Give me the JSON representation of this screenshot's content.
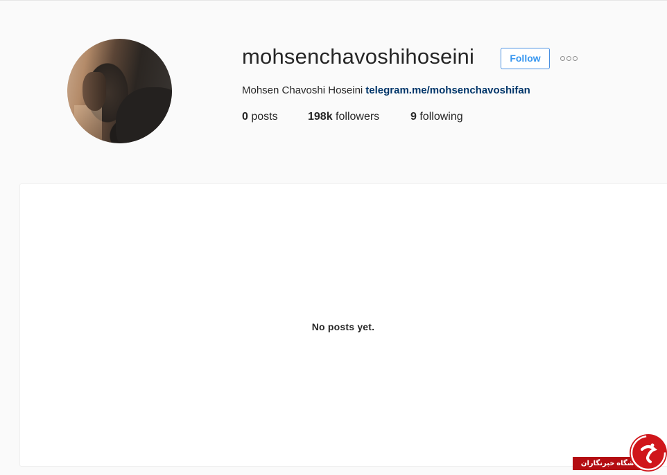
{
  "profile": {
    "username": "mohsenchavoshihoseini",
    "follow_label": "Follow",
    "full_name": "Mohsen Chavoshi Hoseini",
    "bio_link": "telegram.me/mohsenchavoshifan",
    "stats": {
      "posts_count": "0",
      "posts_label": "posts",
      "followers_count": "198k",
      "followers_label": "followers",
      "following_count": "9",
      "following_label": "following"
    }
  },
  "icons": {
    "more": "more-options-icon",
    "avatar": "profile-photo"
  },
  "posts": {
    "empty_message": "No posts yet."
  },
  "watermark": {
    "text": "باشگاه خبرنگاران"
  },
  "colors": {
    "follow_accent": "#3897f0",
    "link": "#003569",
    "background": "#fafafa",
    "watermark_red": "#d0161b"
  }
}
